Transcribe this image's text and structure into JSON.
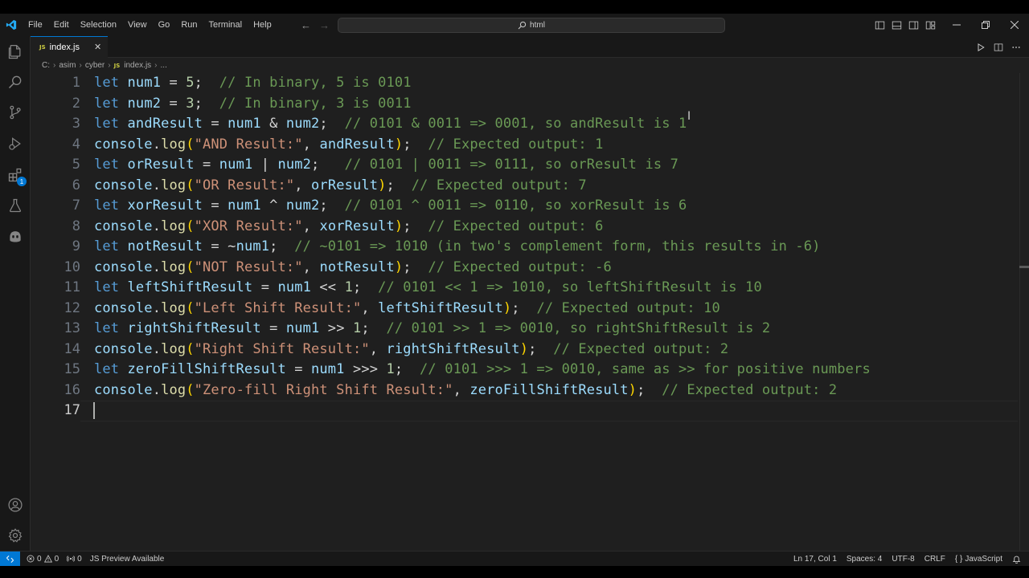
{
  "titlebar": {
    "menu": [
      "File",
      "Edit",
      "Selection",
      "View",
      "Go",
      "Run",
      "Terminal",
      "Help"
    ],
    "search_text": "html"
  },
  "tab": {
    "badge": "JS",
    "label": "index.js",
    "close": "✕"
  },
  "breadcrumb": {
    "items": [
      "C:",
      "asim",
      "cyber",
      "index.js",
      "..."
    ],
    "file_badge": "JS"
  },
  "editor": {
    "active_line": 17,
    "line_numbers": [
      "1",
      "2",
      "3",
      "4",
      "5",
      "6",
      "7",
      "8",
      "9",
      "10",
      "11",
      "12",
      "13",
      "14",
      "15",
      "16",
      "17"
    ],
    "lines": [
      [
        [
          "kw",
          "let "
        ],
        [
          "var",
          "num1"
        ],
        [
          "op",
          " = "
        ],
        [
          "num",
          "5"
        ],
        [
          "op",
          ";  "
        ],
        [
          "cm",
          "// In binary, 5 is 0101"
        ]
      ],
      [
        [
          "kw",
          "let "
        ],
        [
          "var",
          "num2"
        ],
        [
          "op",
          " = "
        ],
        [
          "num",
          "3"
        ],
        [
          "op",
          ";  "
        ],
        [
          "cm",
          "// In binary, 3 is 0011"
        ]
      ],
      [
        [
          "kw",
          "let "
        ],
        [
          "var",
          "andResult"
        ],
        [
          "op",
          " = "
        ],
        [
          "var",
          "num1"
        ],
        [
          "op",
          " & "
        ],
        [
          "var",
          "num2"
        ],
        [
          "op",
          ";  "
        ],
        [
          "cm",
          "// 0101 & 0011 => 0001, so andResult is 1"
        ]
      ],
      [
        [
          "var",
          "console"
        ],
        [
          "op",
          "."
        ],
        [
          "fn",
          "log"
        ],
        [
          "br",
          "("
        ],
        [
          "str",
          "\"AND Result:\""
        ],
        [
          "op",
          ", "
        ],
        [
          "var",
          "andResult"
        ],
        [
          "br",
          ")"
        ],
        [
          "op",
          ";  "
        ],
        [
          "cm",
          "// Expected output: 1"
        ]
      ],
      [
        [
          "kw",
          "let "
        ],
        [
          "var",
          "orResult"
        ],
        [
          "op",
          " = "
        ],
        [
          "var",
          "num1"
        ],
        [
          "op",
          " | "
        ],
        [
          "var",
          "num2"
        ],
        [
          "op",
          ";   "
        ],
        [
          "cm",
          "// 0101 | 0011 => 0111, so orResult is 7"
        ]
      ],
      [
        [
          "var",
          "console"
        ],
        [
          "op",
          "."
        ],
        [
          "fn",
          "log"
        ],
        [
          "br",
          "("
        ],
        [
          "str",
          "\"OR Result:\""
        ],
        [
          "op",
          ", "
        ],
        [
          "var",
          "orResult"
        ],
        [
          "br",
          ")"
        ],
        [
          "op",
          ";  "
        ],
        [
          "cm",
          "// Expected output: 7"
        ]
      ],
      [
        [
          "kw",
          "let "
        ],
        [
          "var",
          "xorResult"
        ],
        [
          "op",
          " = "
        ],
        [
          "var",
          "num1"
        ],
        [
          "op",
          " ^ "
        ],
        [
          "var",
          "num2"
        ],
        [
          "op",
          ";  "
        ],
        [
          "cm",
          "// 0101 ^ 0011 => 0110, so xorResult is 6"
        ]
      ],
      [
        [
          "var",
          "console"
        ],
        [
          "op",
          "."
        ],
        [
          "fn",
          "log"
        ],
        [
          "br",
          "("
        ],
        [
          "str",
          "\"XOR Result:\""
        ],
        [
          "op",
          ", "
        ],
        [
          "var",
          "xorResult"
        ],
        [
          "br",
          ")"
        ],
        [
          "op",
          ";  "
        ],
        [
          "cm",
          "// Expected output: 6"
        ]
      ],
      [
        [
          "kw",
          "let "
        ],
        [
          "var",
          "notResult"
        ],
        [
          "op",
          " = ~"
        ],
        [
          "var",
          "num1"
        ],
        [
          "op",
          ";  "
        ],
        [
          "cm",
          "// ~0101 => 1010 (in two's complement form, this results in -6)"
        ]
      ],
      [
        [
          "var",
          "console"
        ],
        [
          "op",
          "."
        ],
        [
          "fn",
          "log"
        ],
        [
          "br",
          "("
        ],
        [
          "str",
          "\"NOT Result:\""
        ],
        [
          "op",
          ", "
        ],
        [
          "var",
          "notResult"
        ],
        [
          "br",
          ")"
        ],
        [
          "op",
          ";  "
        ],
        [
          "cm",
          "// Expected output: -6"
        ]
      ],
      [
        [
          "kw",
          "let "
        ],
        [
          "var",
          "leftShiftResult"
        ],
        [
          "op",
          " = "
        ],
        [
          "var",
          "num1"
        ],
        [
          "op",
          " << "
        ],
        [
          "num",
          "1"
        ],
        [
          "op",
          ";  "
        ],
        [
          "cm",
          "// 0101 << 1 => 1010, so leftShiftResult is 10"
        ]
      ],
      [
        [
          "var",
          "console"
        ],
        [
          "op",
          "."
        ],
        [
          "fn",
          "log"
        ],
        [
          "br",
          "("
        ],
        [
          "str",
          "\"Left Shift Result:\""
        ],
        [
          "op",
          ", "
        ],
        [
          "var",
          "leftShiftResult"
        ],
        [
          "br",
          ")"
        ],
        [
          "op",
          ";  "
        ],
        [
          "cm",
          "// Expected output: 10"
        ]
      ],
      [
        [
          "kw",
          "let "
        ],
        [
          "var",
          "rightShiftResult"
        ],
        [
          "op",
          " = "
        ],
        [
          "var",
          "num1"
        ],
        [
          "op",
          " >> "
        ],
        [
          "num",
          "1"
        ],
        [
          "op",
          ";  "
        ],
        [
          "cm",
          "// 0101 >> 1 => 0010, so rightShiftResult is 2"
        ]
      ],
      [
        [
          "var",
          "console"
        ],
        [
          "op",
          "."
        ],
        [
          "fn",
          "log"
        ],
        [
          "br",
          "("
        ],
        [
          "str",
          "\"Right Shift Result:\""
        ],
        [
          "op",
          ", "
        ],
        [
          "var",
          "rightShiftResult"
        ],
        [
          "br",
          ")"
        ],
        [
          "op",
          ";  "
        ],
        [
          "cm",
          "// Expected output: 2"
        ]
      ],
      [
        [
          "kw",
          "let "
        ],
        [
          "var",
          "zeroFillShiftResult"
        ],
        [
          "op",
          " = "
        ],
        [
          "var",
          "num1"
        ],
        [
          "op",
          " >>> "
        ],
        [
          "num",
          "1"
        ],
        [
          "op",
          ";  "
        ],
        [
          "cm",
          "// 0101 >>> 1 => 0010, same as >> for positive numbers"
        ]
      ],
      [
        [
          "var",
          "console"
        ],
        [
          "op",
          "."
        ],
        [
          "fn",
          "log"
        ],
        [
          "br",
          "("
        ],
        [
          "str",
          "\"Zero-fill Right Shift Result:\""
        ],
        [
          "op",
          ", "
        ],
        [
          "var",
          "zeroFillShiftResult"
        ],
        [
          "br",
          ")"
        ],
        [
          "op",
          ";  "
        ],
        [
          "cm",
          "// Expected output: 2"
        ]
      ],
      []
    ]
  },
  "statusbar": {
    "errors": "0",
    "warnings": "0",
    "ports": "0",
    "preview": "JS Preview Available",
    "position": "Ln 17, Col 1",
    "spaces": "Spaces: 4",
    "encoding": "UTF-8",
    "eol": "CRLF",
    "language_glyph": "{ }",
    "language": "JavaScript"
  },
  "colors": {
    "accent": "#0078d4",
    "keyword": "#569cd6",
    "variable": "#9cdcfe",
    "function": "#dcdcaa",
    "string": "#ce9178",
    "number": "#b5cea8",
    "comment": "#6a9955",
    "bracket": "#ffd700"
  },
  "icons": {
    "activity": [
      "explorer-icon",
      "search-icon",
      "source-control-icon",
      "run-debug-icon",
      "extensions-icon",
      "testing-icon",
      "copilot-icon",
      "account-icon",
      "settings-gear-icon"
    ],
    "extensions_badge": "1"
  }
}
